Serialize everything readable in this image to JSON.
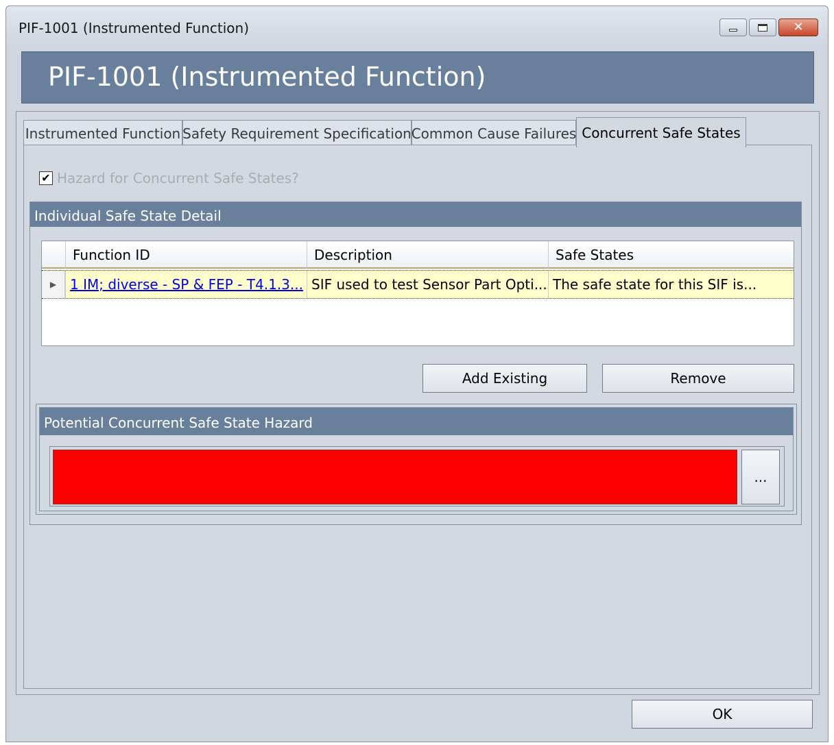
{
  "window": {
    "title": "PIF-1001 (Instrumented Function)",
    "controls": [
      "minimize",
      "maximize",
      "close"
    ]
  },
  "banner": {
    "title": "PIF-1001 (Instrumented Function)"
  },
  "tabs": [
    {
      "label": "Instrumented Function",
      "active": false
    },
    {
      "label": "Safety Requirement Specification",
      "active": false
    },
    {
      "label": "Common Cause Failures",
      "active": false
    },
    {
      "label": "Concurrent Safe States",
      "active": true
    }
  ],
  "checkbox": {
    "label": "Hazard for Concurrent Safe States?",
    "checked": true,
    "enabled": false,
    "glyph": "✔"
  },
  "detail_group": {
    "title": "Individual Safe State Detail",
    "columns": [
      "Function ID",
      "Description",
      "Safe States"
    ],
    "rows": [
      {
        "function_id": "1 IM; diverse - SP & FEP - T4.1.3...",
        "description": "SIF used to test Sensor Part Opti...",
        "safe_states": "The safe state for this SIF is..."
      }
    ],
    "add_existing_label": "Add Existing",
    "remove_label": "Remove"
  },
  "hazard_group": {
    "title": "Potential Concurrent Safe State Hazard",
    "value": "",
    "field_color": "#ff0000",
    "ellipsis_label": "..."
  },
  "ok_label": "OK",
  "colors": {
    "header_blue": "#69809c",
    "panel": "#d3d9e0",
    "row_highlight": "#ffffcc"
  }
}
